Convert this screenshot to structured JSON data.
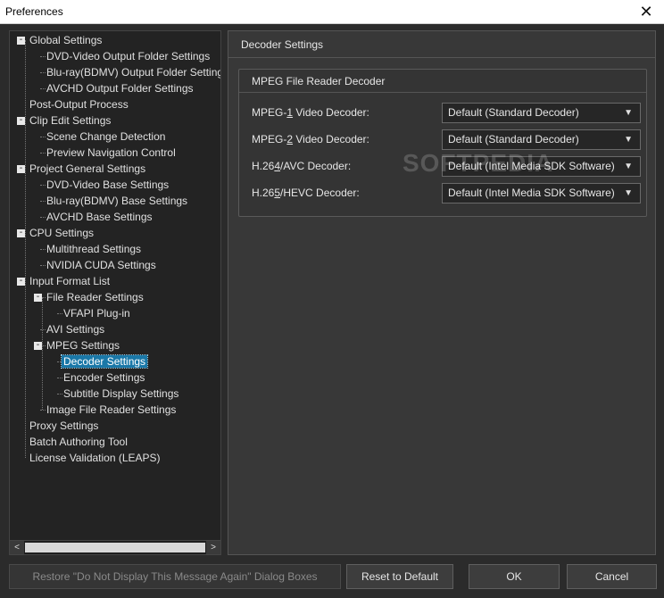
{
  "window": {
    "title": "Preferences",
    "close_glyph": "✕"
  },
  "tree": {
    "items": [
      {
        "label": "Global Settings",
        "level": 0,
        "expander": "-"
      },
      {
        "label": "DVD-Video Output Folder Settings",
        "level": 1
      },
      {
        "label": "Blu-ray(BDMV) Output Folder Settings",
        "level": 1
      },
      {
        "label": "AVCHD Output Folder Settings",
        "level": 1
      },
      {
        "label": "Post-Output Process",
        "level": 0
      },
      {
        "label": "Clip Edit Settings",
        "level": 0,
        "expander": "-"
      },
      {
        "label": "Scene Change Detection",
        "level": 1
      },
      {
        "label": "Preview Navigation Control",
        "level": 1
      },
      {
        "label": "Project General Settings",
        "level": 0,
        "expander": "-"
      },
      {
        "label": "DVD-Video Base Settings",
        "level": 1
      },
      {
        "label": "Blu-ray(BDMV) Base Settings",
        "level": 1
      },
      {
        "label": "AVCHD Base Settings",
        "level": 1
      },
      {
        "label": "CPU Settings",
        "level": 0,
        "expander": "-"
      },
      {
        "label": "Multithread Settings",
        "level": 1
      },
      {
        "label": "NVIDIA CUDA Settings",
        "level": 1
      },
      {
        "label": "Input Format List",
        "level": 0,
        "expander": "-"
      },
      {
        "label": "File Reader Settings",
        "level": 1,
        "expander": "-"
      },
      {
        "label": "VFAPI Plug-in",
        "level": 2
      },
      {
        "label": "AVI Settings",
        "level": 1
      },
      {
        "label": "MPEG Settings",
        "level": 1,
        "expander": "-"
      },
      {
        "label": "Decoder Settings",
        "level": 2,
        "selected": true
      },
      {
        "label": "Encoder Settings",
        "level": 2
      },
      {
        "label": "Subtitle Display Settings",
        "level": 2
      },
      {
        "label": "Image File Reader Settings",
        "level": 1
      },
      {
        "label": "Proxy Settings",
        "level": 0
      },
      {
        "label": "Batch Authoring Tool",
        "level": 0
      },
      {
        "label": "License Validation (LEAPS)",
        "level": 0
      }
    ],
    "scroll_left": "<",
    "scroll_right": ">"
  },
  "content": {
    "header": "Decoder Settings",
    "group_title": "MPEG File Reader Decoder",
    "fields": [
      {
        "label_pre": "MPEG-",
        "label_u": "1",
        "label_post": " Video Decoder:",
        "value": "Default (Standard Decoder)"
      },
      {
        "label_pre": "MPEG-",
        "label_u": "2",
        "label_post": " Video Decoder:",
        "value": "Default (Standard Decoder)"
      },
      {
        "label_pre": "H.26",
        "label_u": "4",
        "label_post": "/AVC Decoder:",
        "value": "Default (Intel Media SDK Software)"
      },
      {
        "label_pre": "H.26",
        "label_u": "5",
        "label_post": "/HEVC Decoder:",
        "value": "Default (Intel Media SDK Software)"
      }
    ],
    "caret": "▼",
    "watermark": "SOFTPEDIA"
  },
  "buttons": {
    "restore": "Restore \"Do Not Display This Message Again\" Dialog Boxes",
    "reset": "Reset to Default",
    "ok": "OK",
    "cancel": "Cancel"
  }
}
